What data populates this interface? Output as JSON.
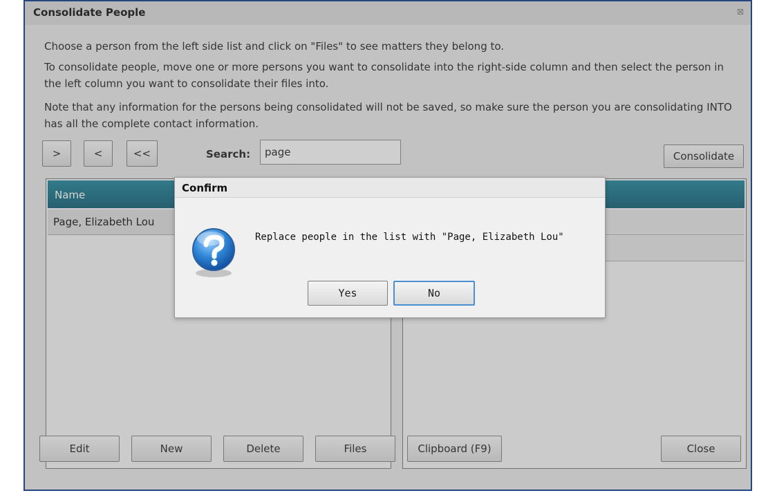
{
  "window": {
    "title": "Consolidate People",
    "close_glyph": "☒",
    "instructions": [
      "Choose a person from the left side list and click on \"Files\" to see matters they belong to.",
      "To consolidate people, move one or more persons you want to consolidate into the right-side column and then select the person in the left column you want to consolidate their files into.",
      "Note that any information for the persons being consolidated will not be saved, so make sure the person you are consolidating INTO has all the complete contact information."
    ]
  },
  "toolbar": {
    "move_right_label": ">",
    "move_left_label": "<",
    "move_all_left_label": "<<",
    "search_label": "Search:",
    "search_value": "page",
    "consolidate_label": "Consolidate"
  },
  "left_list": {
    "header": "Name",
    "rows": [
      "Page, Elizabeth Lou"
    ]
  },
  "bottom_buttons": {
    "edit": "Edit",
    "new": "New",
    "delete": "Delete",
    "files": "Files",
    "clipboard": "Clipboard (F9)",
    "close": "Close"
  },
  "dialog": {
    "title": "Confirm",
    "icon": "question-icon",
    "message": "Replace people in the list with \"Page, Elizabeth Lou\"",
    "yes_label": "Yes",
    "no_label": "No"
  },
  "colors": {
    "window_border": "#24457d",
    "header_teal": "#14697f",
    "focus_blue": "#4a8fcf"
  }
}
